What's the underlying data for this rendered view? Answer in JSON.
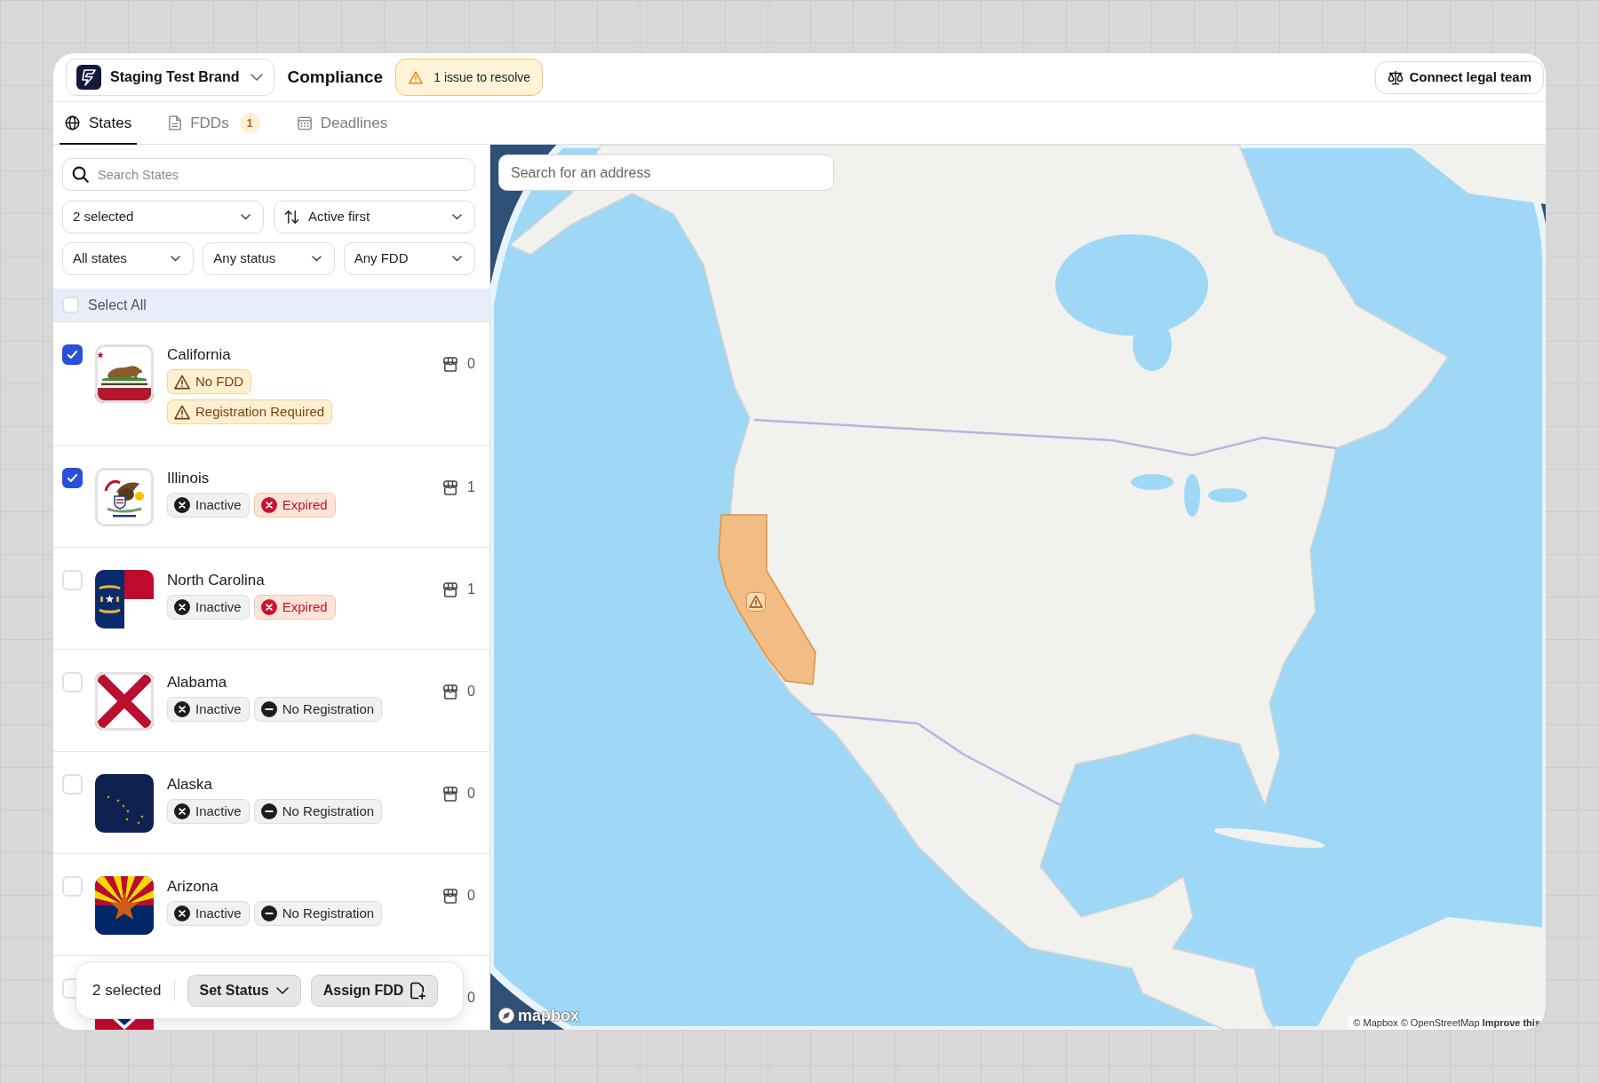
{
  "header": {
    "brand": "Staging Test Brand",
    "title": "Compliance",
    "issue_badge": "1 issue to resolve",
    "action_button": "Connect legal team"
  },
  "tabs": [
    {
      "label": "States",
      "selected": true
    },
    {
      "label": "FDDs",
      "selected": false,
      "count": "1"
    },
    {
      "label": "Deadlines",
      "selected": false
    }
  ],
  "states_panel": {
    "search": {
      "placeholder": "Search States"
    },
    "filter_rows": [
      {
        "dropdowns": [
          {
            "kind": "select",
            "label": "2 selected"
          },
          {
            "kind": "sort",
            "label": "Active first"
          }
        ]
      },
      {
        "dropdowns": [
          {
            "kind": "select",
            "label": "All states"
          },
          {
            "kind": "select",
            "label": "Any status"
          },
          {
            "kind": "select",
            "label": "Any FDD"
          }
        ]
      }
    ],
    "select_all": {
      "label": "Select All",
      "checked": false
    },
    "states": [
      {
        "name": "California",
        "checked": true,
        "badges": [
          {
            "kind": "warning",
            "label": "No FDD"
          },
          {
            "kind": "warning",
            "label": "Registration Required"
          }
        ],
        "count": "0"
      },
      {
        "name": "Illinois",
        "checked": true,
        "badges": [
          {
            "kind": "inactive",
            "label": "Inactive"
          },
          {
            "kind": "expired",
            "label": "Expired"
          }
        ],
        "count": "1"
      },
      {
        "name": "North Carolina",
        "checked": false,
        "badges": [
          {
            "kind": "inactive",
            "label": "Inactive"
          },
          {
            "kind": "expired",
            "label": "Expired"
          }
        ],
        "count": "1"
      },
      {
        "name": "Alabama",
        "checked": false,
        "badges": [
          {
            "kind": "inactive",
            "label": "Inactive"
          },
          {
            "kind": "unregistered",
            "label": "No Registration"
          }
        ],
        "count": "0"
      },
      {
        "name": "Alaska",
        "checked": false,
        "badges": [
          {
            "kind": "inactive",
            "label": "Inactive"
          },
          {
            "kind": "unregistered",
            "label": "No Registration"
          }
        ],
        "count": "0"
      },
      {
        "name": "Arizona",
        "checked": false,
        "badges": [
          {
            "kind": "inactive",
            "label": "Inactive"
          },
          {
            "kind": "unregistered",
            "label": "No Registration"
          }
        ],
        "count": "0"
      },
      {
        "checked": false,
        "count": "0"
      }
    ],
    "selection_bar": {
      "label": "2 selected",
      "buttons": [
        {
          "kind": "menu",
          "label": "Set Status"
        },
        {
          "kind": "assign",
          "label": "Assign FDD"
        }
      ]
    }
  },
  "map": {
    "search": {
      "placeholder": "Search for an address"
    },
    "logo": "mapbox",
    "attribution": "© Mapbox © OpenStreetMap **Improve this**"
  }
}
